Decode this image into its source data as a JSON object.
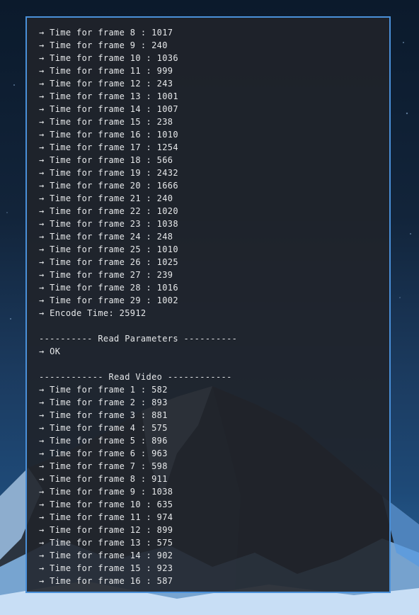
{
  "terminal": {
    "lines": [
      "→ Time for frame 8 : 1017",
      "→ Time for frame 9 : 240",
      "→ Time for frame 10 : 1036",
      "→ Time for frame 11 : 999",
      "→ Time for frame 12 : 243",
      "→ Time for frame 13 : 1001",
      "→ Time for frame 14 : 1007",
      "→ Time for frame 15 : 238",
      "→ Time for frame 16 : 1010",
      "→ Time for frame 17 : 1254",
      "→ Time for frame 18 : 566",
      "→ Time for frame 19 : 2432",
      "→ Time for frame 20 : 1666",
      "→ Time for frame 21 : 240",
      "→ Time for frame 22 : 1020",
      "→ Time for frame 23 : 1038",
      "→ Time for frame 24 : 248",
      "→ Time for frame 25 : 1010",
      "→ Time for frame 26 : 1025",
      "→ Time for frame 27 : 239",
      "→ Time for frame 28 : 1016",
      "→ Time for frame 29 : 1002",
      "→ Encode Time: 25912",
      "",
      "---------- Read Parameters ----------",
      "→ OK",
      "",
      "------------ Read Video ------------",
      "→ Time for frame 1 : 582",
      "→ Time for frame 2 : 893",
      "→ Time for frame 3 : 881",
      "→ Time for frame 4 : 575",
      "→ Time for frame 5 : 896",
      "→ Time for frame 6 : 963",
      "→ Time for frame 7 : 598",
      "→ Time for frame 8 : 911",
      "→ Time for frame 9 : 1038",
      "→ Time for frame 10 : 635",
      "→ Time for frame 11 : 974",
      "→ Time for frame 12 : 899",
      "→ Time for frame 13 : 575",
      "→ Time for frame 14 : 902",
      "→ Time for frame 15 : 923",
      "→ Time for frame 16 : 587"
    ]
  },
  "colors": {
    "terminal_border": "#4a90d9",
    "terminal_background": "#20242a",
    "terminal_text": "#e6e8ea"
  }
}
